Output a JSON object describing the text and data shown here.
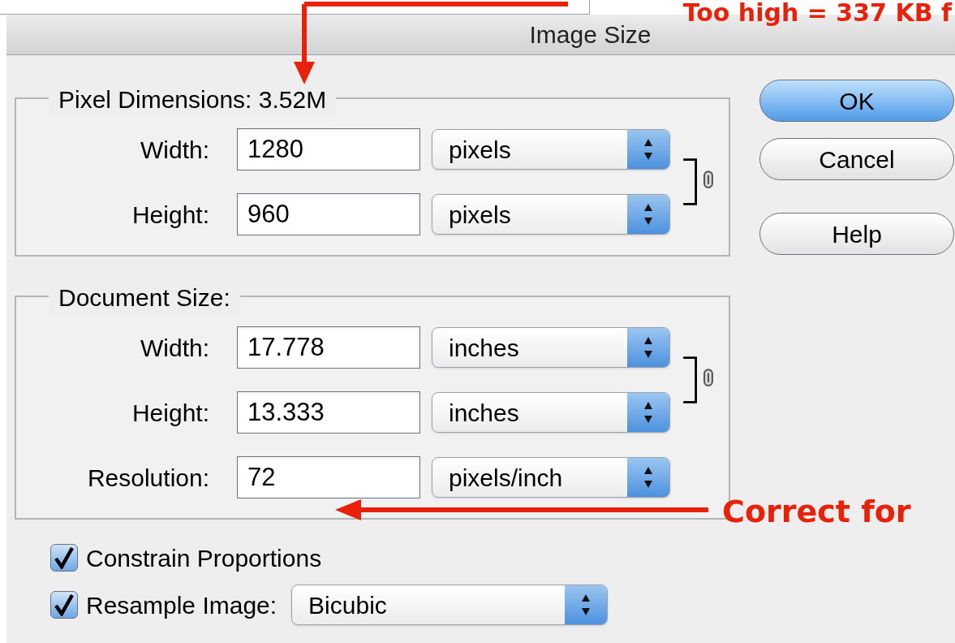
{
  "window": {
    "title": "Image Size"
  },
  "groups": [
    {
      "legend": "Pixel Dimensions: 3.52M",
      "rows": [
        {
          "label": "Width:",
          "value": "1280",
          "unit": "pixels",
          "linked": true
        },
        {
          "label": "Height:",
          "value": "960",
          "unit": "pixels",
          "linked": true
        }
      ]
    },
    {
      "legend": "Document Size:",
      "rows": [
        {
          "label": "Width:",
          "value": "17.778",
          "unit": "inches",
          "linked": true
        },
        {
          "label": "Height:",
          "value": "13.333",
          "unit": "inches",
          "linked": true
        },
        {
          "label": "Resolution:",
          "value": "72",
          "unit": "pixels/inch",
          "linked": false
        }
      ]
    }
  ],
  "buttons": [
    {
      "label": "OK",
      "default": true
    },
    {
      "label": "Cancel",
      "default": false
    },
    {
      "label": "Help",
      "default": false
    }
  ],
  "options": [
    {
      "kind": "checkbox",
      "label": "Constrain Proportions",
      "checked": true
    },
    {
      "kind": "checkbox_select",
      "label": "Resample Image:",
      "checked": true,
      "value": "Bicubic"
    }
  ],
  "annotations": [
    {
      "text": "Too high = 337 KB f"
    },
    {
      "text": "Correct for"
    }
  ]
}
